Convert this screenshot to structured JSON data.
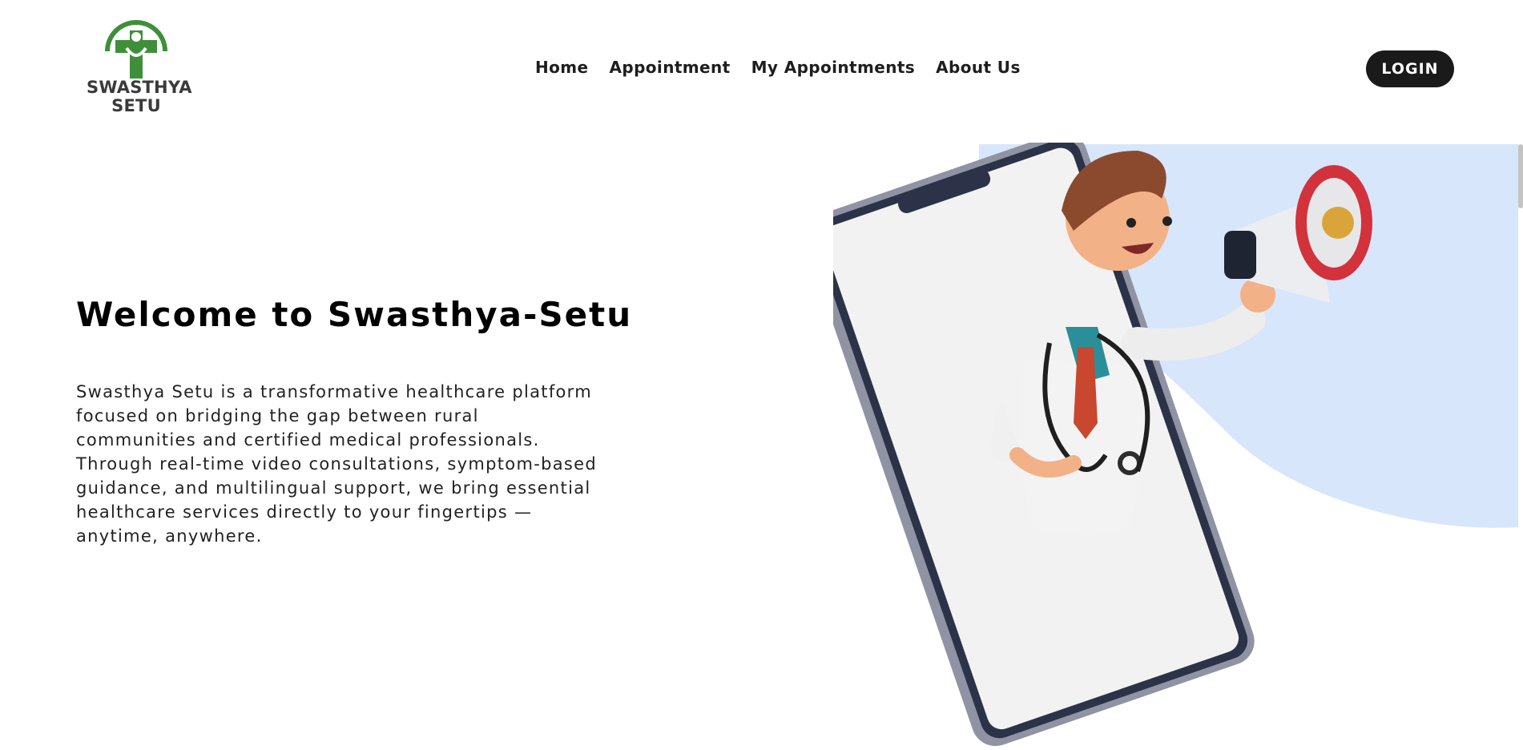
{
  "brand": {
    "name_line1": "SWASTHYA",
    "name_line2": "SETU",
    "primary_color": "#3f8f3a"
  },
  "nav": {
    "items": [
      {
        "label": "Home"
      },
      {
        "label": "Appointment"
      },
      {
        "label": "My Appointments"
      },
      {
        "label": "About Us"
      }
    ]
  },
  "header": {
    "login_label": "LOGIN"
  },
  "hero": {
    "title": "Welcome to Swasthya-Setu",
    "description": "Swasthya Setu is a transformative healthcare platform focused on bridging the gap between rural communities and certified medical professionals. Through real-time video consultations, symptom-based guidance, and multilingual support, we bring essential healthcare services directly to your fingertips — anytime, anywhere.",
    "illustration": "doctor-with-megaphone-coming-out-of-phone"
  },
  "colors": {
    "accent_bg": "#d7e6fb",
    "button_bg": "#1a1a1a"
  }
}
